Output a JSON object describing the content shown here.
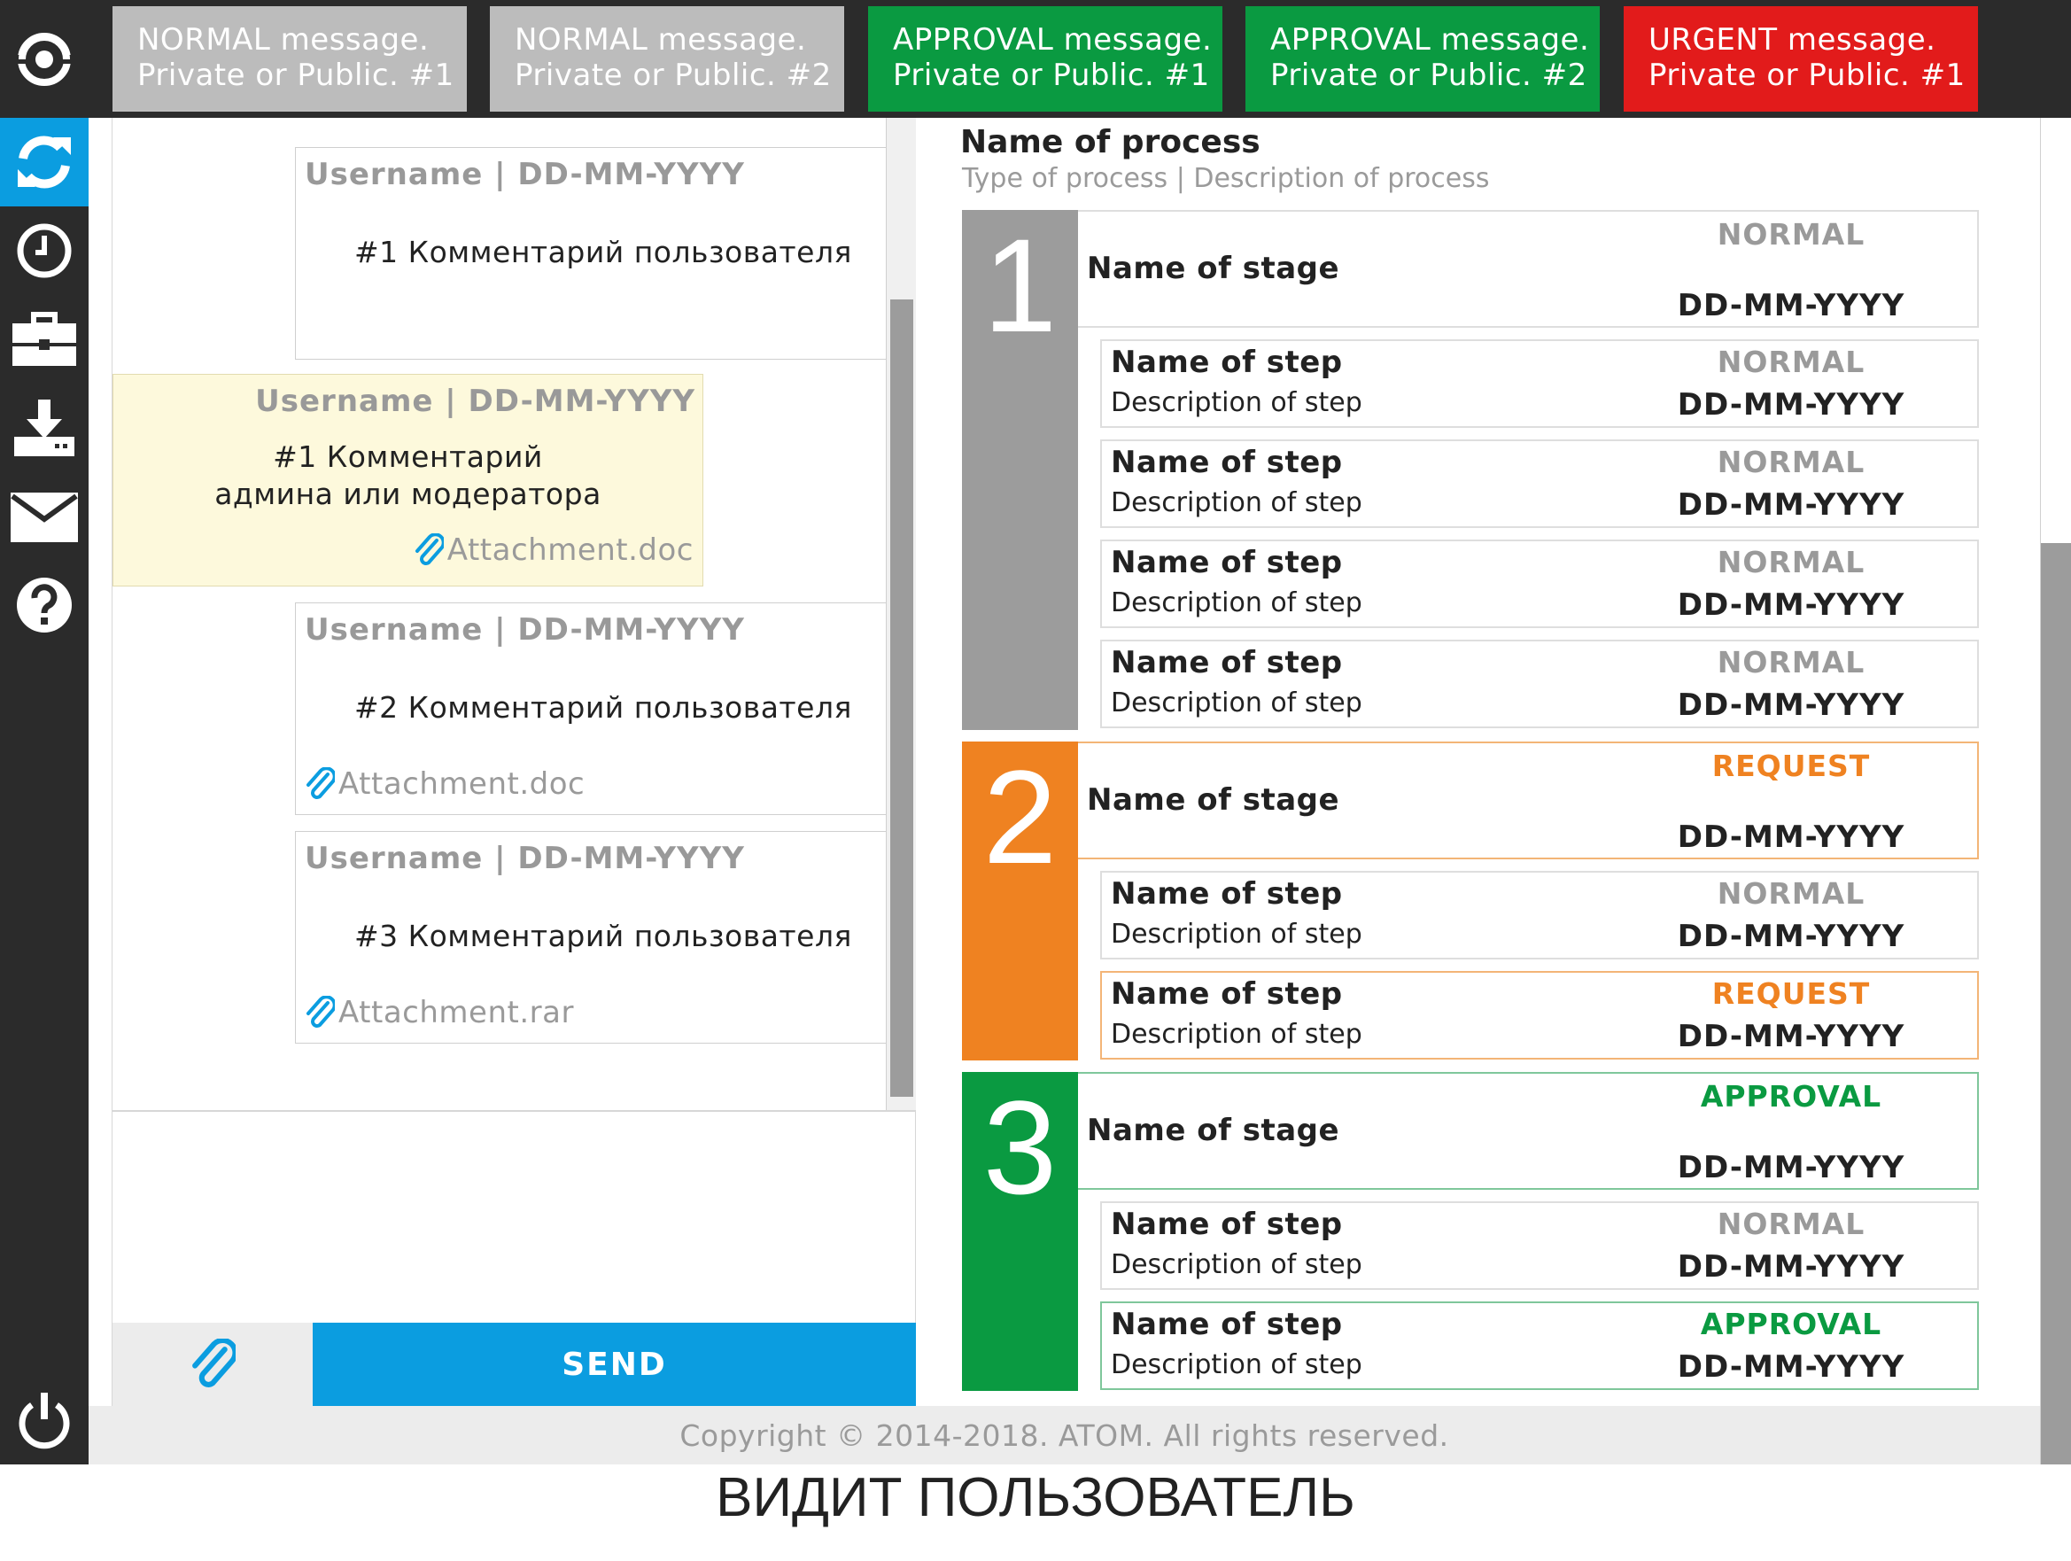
{
  "messages": [
    {
      "line1": "NORMAL message.",
      "line2": "Private or Public. #1",
      "kind": "normal"
    },
    {
      "line1": "NORMAL message.",
      "line2": "Private or Public. #2",
      "kind": "normal"
    },
    {
      "line1": "APPROVAL message.",
      "line2": "Private or Public. #1",
      "kind": "approval"
    },
    {
      "line1": "APPROVAL message.",
      "line2": "Private or Public. #2",
      "kind": "approval"
    },
    {
      "line1": "URGENT message.",
      "line2": "Private or Public. #1",
      "kind": "urgent"
    }
  ],
  "sidebar": {
    "items": [
      {
        "icon": "refresh-icon",
        "active": true
      },
      {
        "icon": "clock-icon"
      },
      {
        "icon": "briefcase-icon"
      },
      {
        "icon": "download-icon"
      },
      {
        "icon": "mail-icon"
      },
      {
        "icon": "help-icon"
      }
    ],
    "bottom_icon": "power-icon"
  },
  "chat": {
    "comments": [
      {
        "head": "Username | DD-MM-YYYY",
        "text": "#1 Комментарий пользователя",
        "attachment": ""
      },
      {
        "head": "Username | DD-MM-YYYY",
        "text_line1": "#1 Комментарий",
        "text_line2": "админа или модератора",
        "attachment": "Attachment.doc",
        "admin": true
      },
      {
        "head": "Username | DD-MM-YYYY",
        "text": "#2 Комментарий пользователя",
        "attachment": "Attachment.doc"
      },
      {
        "head": "Username | DD-MM-YYYY",
        "text": "#3 Комментарий пользователя",
        "attachment": "Attachment.rar"
      }
    ],
    "send_label": "SEND"
  },
  "process": {
    "title": "Name of process",
    "subtitle": "Type of process | Description of process",
    "stages": [
      {
        "number": "1",
        "color": "#9c9c9c",
        "name": "Name of stage",
        "status": "NORMAL",
        "date": "DD-MM-YYYY",
        "steps": [
          {
            "name": "Name of step",
            "desc": "Description of step",
            "status": "NORMAL",
            "date": "DD-MM-YYYY"
          },
          {
            "name": "Name of step",
            "desc": "Description of step",
            "status": "NORMAL",
            "date": "DD-MM-YYYY"
          },
          {
            "name": "Name of step",
            "desc": "Description of step",
            "status": "NORMAL",
            "date": "DD-MM-YYYY"
          },
          {
            "name": "Name of step",
            "desc": "Description of step",
            "status": "NORMAL",
            "date": "DD-MM-YYYY"
          }
        ]
      },
      {
        "number": "2",
        "color": "#ef8221",
        "name": "Name of stage",
        "status": "REQUEST",
        "date": "DD-MM-YYYY",
        "steps": [
          {
            "name": "Name of step",
            "desc": "Description of step",
            "status": "NORMAL",
            "date": "DD-MM-YYYY"
          },
          {
            "name": "Name of step",
            "desc": "Description of step",
            "status": "REQUEST",
            "date": "DD-MM-YYYY"
          }
        ]
      },
      {
        "number": "3",
        "color": "#0a9a41",
        "name": "Name of stage",
        "status": "APPROVAL",
        "date": "DD-MM-YYYY",
        "steps": [
          {
            "name": "Name of step",
            "desc": "Description of step",
            "status": "NORMAL",
            "date": "DD-MM-YYYY"
          },
          {
            "name": "Name of step",
            "desc": "Description of step",
            "status": "APPROVAL",
            "date": "DD-MM-YYYY"
          }
        ]
      }
    ]
  },
  "footer": "Copyright © 2014-2018. ATOM. All rights reserved.",
  "caption": "ВИДИТ ПОЛЬЗОВАТЕЛЬ"
}
